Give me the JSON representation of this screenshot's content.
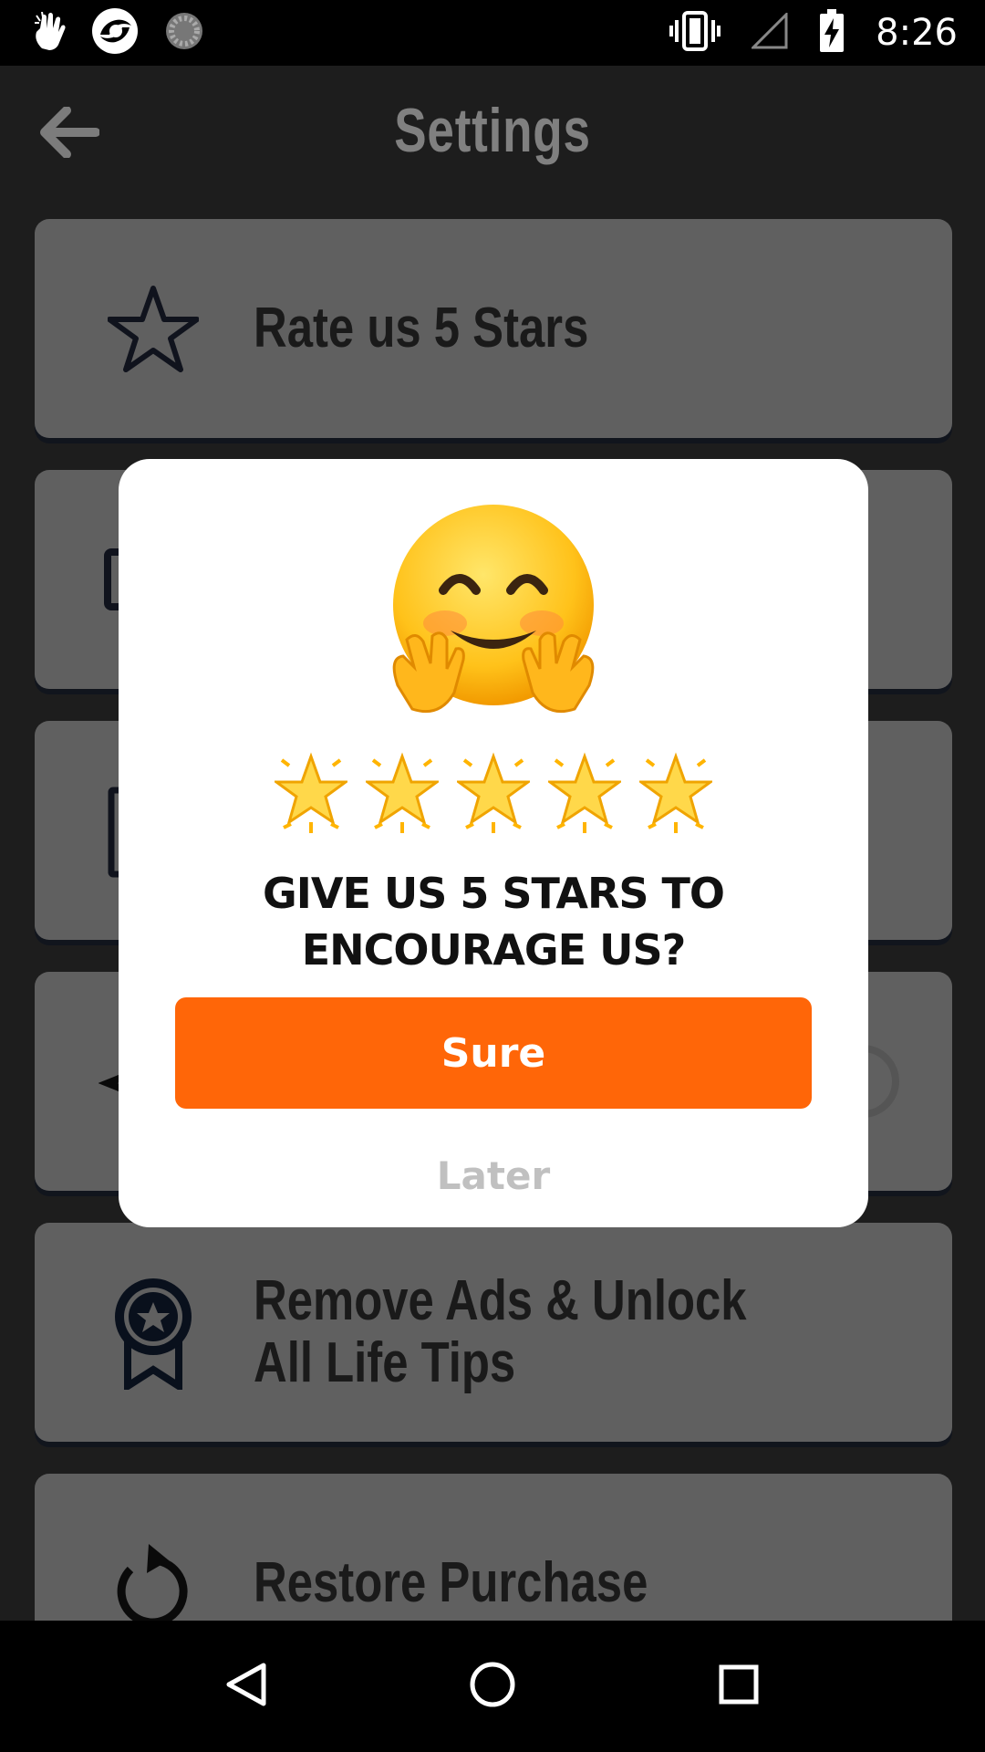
{
  "status_bar": {
    "time": "8:26",
    "left_icons": [
      "hand-pointer-icon",
      "app-circle-icon",
      "loading-spinner-icon"
    ],
    "right_icons": [
      "vibrate-icon",
      "signal-empty-icon",
      "battery-charging-icon"
    ]
  },
  "header": {
    "title": "Settings",
    "back_icon": "arrow-left-icon"
  },
  "settings_rows": [
    {
      "label": "Rate us 5 Stars",
      "icon": "star-outline-icon"
    },
    {
      "label": "",
      "icon": "square-icon"
    },
    {
      "label": "",
      "icon": "rectangle-icon"
    },
    {
      "label": "",
      "icon": "share-icon"
    },
    {
      "label": "Remove Ads & Unlock\nAll Life Tips",
      "icon": "badge-ribbon-icon"
    },
    {
      "label": "Restore Purchase",
      "icon": "restore-icon"
    }
  ],
  "dialog": {
    "emoji": "hugging-face-icon",
    "stars_count": 5,
    "title": "GIVE US 5 STARS TO\nENCOURAGE US?",
    "sure_label": "Sure",
    "later_label": "Later"
  },
  "nav_bar": {
    "buttons": [
      "back-triangle-icon",
      "home-circle-icon",
      "recents-square-icon"
    ]
  },
  "colors": {
    "accent": "#ff6608",
    "row_background": "#9b9b9b",
    "screen_background": "#303030"
  }
}
